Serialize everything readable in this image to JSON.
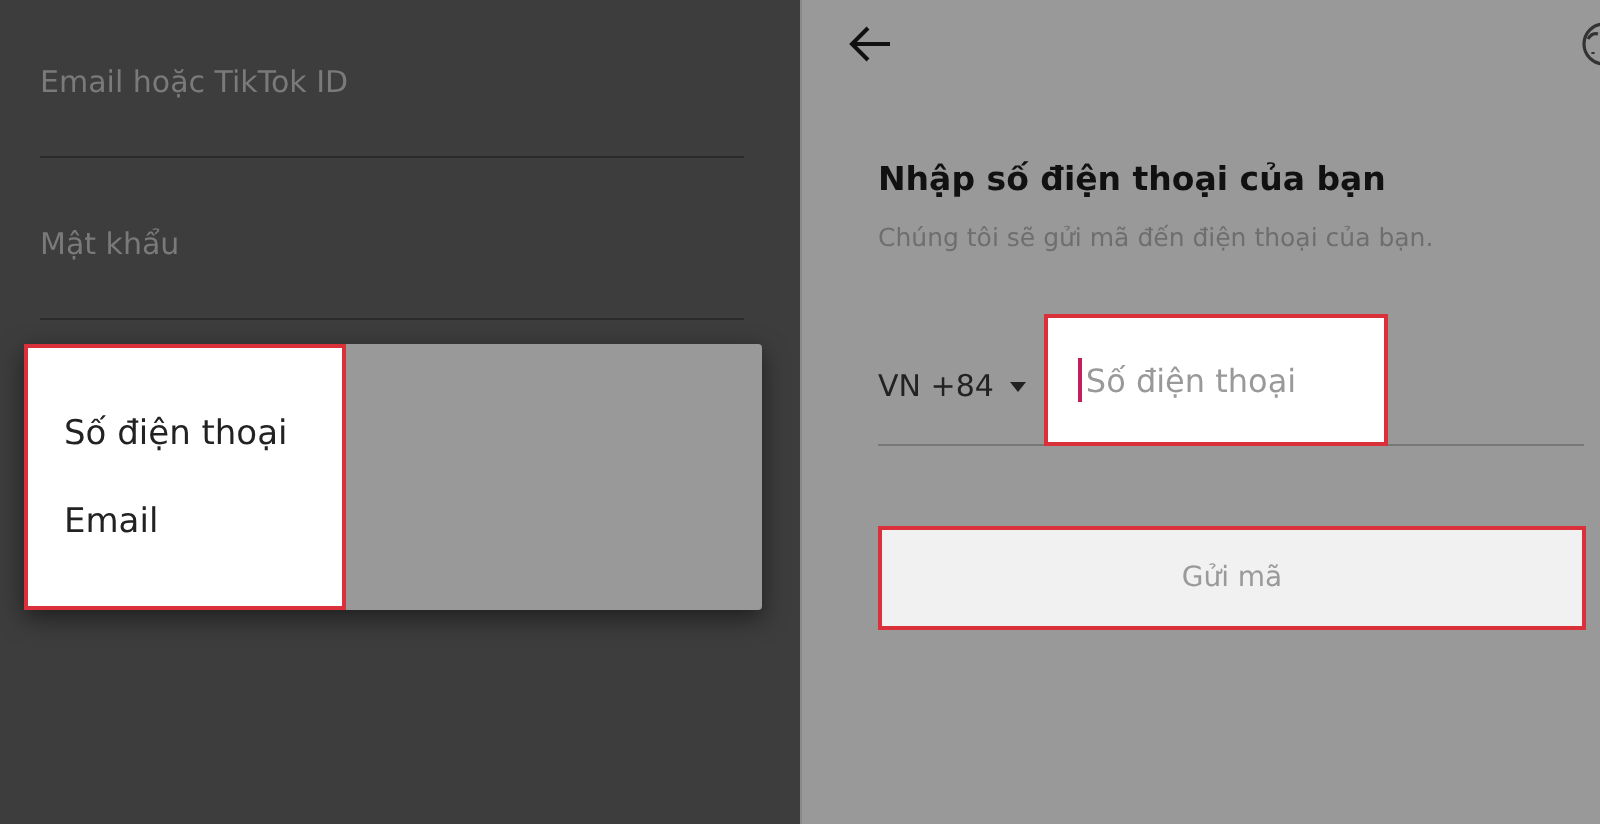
{
  "login_form": {
    "fields": [
      {
        "placeholder": "Email hoặc TikTok ID"
      },
      {
        "placeholder": "Mật khẩu"
      }
    ]
  },
  "type_menu": {
    "highlighted": true,
    "items": [
      {
        "label": "Số điện thoại"
      },
      {
        "label": "Email"
      }
    ]
  },
  "phone_screen": {
    "title": "Nhập số điện thoại của bạn",
    "subtitle": "Chúng tôi sẽ gửi mã đến điện thoại của bạn.",
    "country_code": "VN +84",
    "phone_input": {
      "placeholder": "Số điện thoại",
      "highlighted": true
    },
    "send_button": {
      "label": "Gửi mã",
      "disabled": true,
      "highlighted": true
    }
  }
}
